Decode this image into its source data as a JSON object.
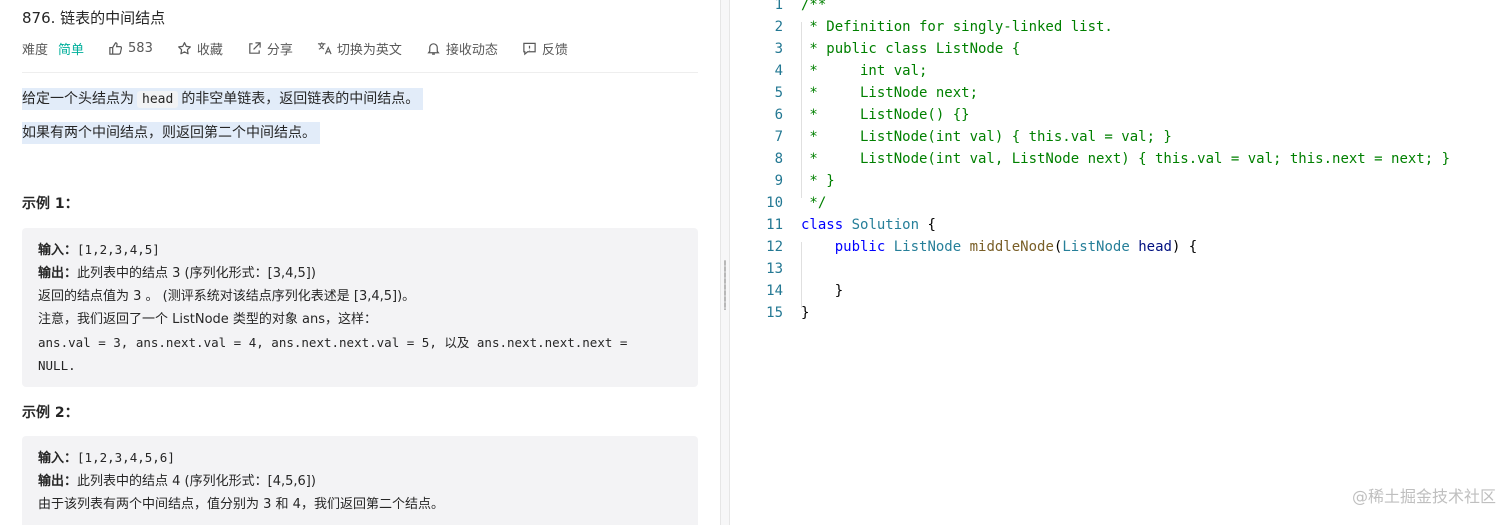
{
  "problem": {
    "title": "876. 链表的中间结点",
    "difficulty_label": "难度",
    "difficulty": "简单",
    "likes": "583",
    "favorite": "收藏",
    "share": "分享",
    "translate": "切换为英文",
    "subscribe": "接收动态",
    "feedback": "反馈",
    "desc_1_before": "给定一个头结点为",
    "desc_1_code": "head",
    "desc_1_after": "的非空单链表，返回链表的中间结点。",
    "desc_2": "如果有两个中间结点，则返回第二个中间结点。"
  },
  "examples": [
    {
      "title": "示例 1：",
      "input_label": "输入：",
      "input_value": "[1,2,3,4,5]",
      "output_label": "输出：",
      "output_value": "此列表中的结点 3 (序列化形式：[3,4,5])",
      "line3": "返回的结点值为 3 。 (测评系统对该结点序列化表述是 [3,4,5])。",
      "line4": "注意，我们返回了一个 ListNode 类型的对象 ans，这样：",
      "line5": "ans.val = 3, ans.next.val = 4, ans.next.next.val = 5, 以及 ans.next.next.next =",
      "line6": "NULL."
    },
    {
      "title": "示例 2：",
      "input_label": "输入：",
      "input_value": "[1,2,3,4,5,6]",
      "output_label": "输出：",
      "output_value": "此列表中的结点 4 (序列化形式：[4,5,6])",
      "line3": "由于该列表有两个中间结点，值分别为 3 和 4，我们返回第二个结点。"
    }
  ],
  "editor": {
    "line_numbers": [
      "1",
      "2",
      "3",
      "4",
      "5",
      "6",
      "7",
      "8",
      "9",
      "10",
      "11",
      "12",
      "13",
      "14",
      "15"
    ],
    "comment_lines": [
      "/**",
      " * Definition for singly-linked list.",
      " * public class ListNode {",
      " *     int val;",
      " *     ListNode next;",
      " *     ListNode() {}",
      " *     ListNode(int val) { this.val = val; }",
      " *     ListNode(int val, ListNode next) { this.val = val; this.next = next; }",
      " * }",
      " */"
    ],
    "class_kw": "class",
    "class_name": "Solution",
    "brace_open": " {",
    "method_modifier": "public",
    "method_return": "ListNode",
    "method_name": "middleNode",
    "param_paren_open": "(",
    "param_type": "ListNode",
    "param_name": "head",
    "param_close": ") {",
    "method_close": "}",
    "class_close": "}"
  },
  "watermark": "@稀土掘金技术社区"
}
